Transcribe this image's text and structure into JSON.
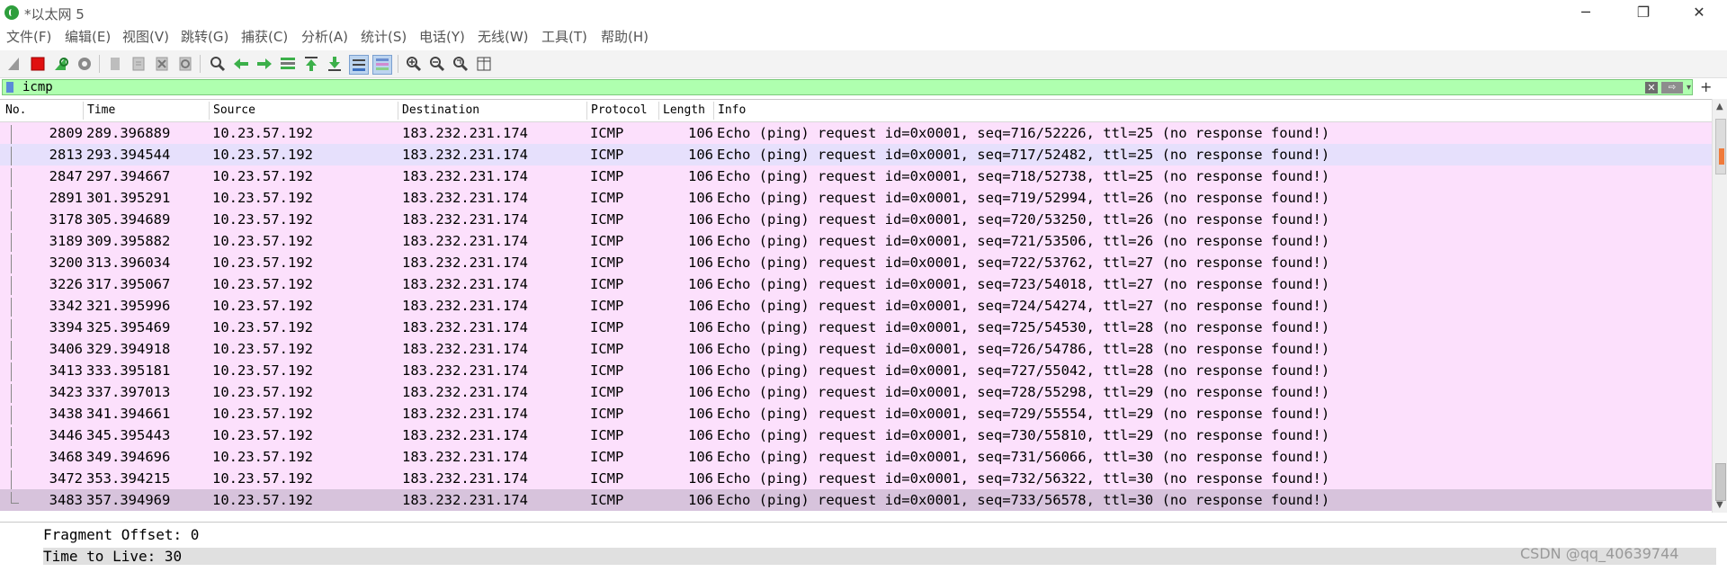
{
  "window": {
    "title": "*以太网 5",
    "minimize": "─",
    "maximize": "❐",
    "close": "✕"
  },
  "menu": [
    "文件(F)",
    "编辑(E)",
    "视图(V)",
    "跳转(G)",
    "捕获(C)",
    "分析(A)",
    "统计(S)",
    "电话(Y)",
    "无线(W)",
    "工具(T)",
    "帮助(H)"
  ],
  "toolbar_icons": [
    "shark-fin-start-icon",
    "stop-capture-icon",
    "restart-capture-icon",
    "capture-options-icon",
    "open-file-icon",
    "save-file-icon",
    "close-file-icon",
    "reload-file-icon",
    "find-packet-icon",
    "go-back-icon",
    "go-forward-icon",
    "go-to-packet-icon",
    "go-first-icon",
    "go-last-icon",
    "autoscroll-icon",
    "colorize-icon",
    "zoom-in-icon",
    "zoom-out-icon",
    "zoom-normal-icon",
    "resize-columns-icon"
  ],
  "filter": {
    "value": "icmp",
    "clear": "✕",
    "apply": "⇨",
    "dropdown": "▾",
    "add": "+"
  },
  "columns": [
    "No.",
    "Time",
    "Source",
    "Destination",
    "Protocol",
    "Length",
    "Info"
  ],
  "packets": [
    {
      "no": "2809",
      "time": "289.396889",
      "src": "10.23.57.192",
      "dst": "183.232.231.174",
      "proto": "ICMP",
      "len": "106",
      "info": "Echo (ping) request  id=0x0001, seq=716/52226, ttl=25 (no response found!)"
    },
    {
      "no": "2813",
      "time": "293.394544",
      "src": "10.23.57.192",
      "dst": "183.232.231.174",
      "proto": "ICMP",
      "len": "106",
      "info": "Echo (ping) request  id=0x0001, seq=717/52482, ttl=25 (no response found!)"
    },
    {
      "no": "2847",
      "time": "297.394667",
      "src": "10.23.57.192",
      "dst": "183.232.231.174",
      "proto": "ICMP",
      "len": "106",
      "info": "Echo (ping) request  id=0x0001, seq=718/52738, ttl=25 (no response found!)"
    },
    {
      "no": "2891",
      "time": "301.395291",
      "src": "10.23.57.192",
      "dst": "183.232.231.174",
      "proto": "ICMP",
      "len": "106",
      "info": "Echo (ping) request  id=0x0001, seq=719/52994, ttl=26 (no response found!)"
    },
    {
      "no": "3178",
      "time": "305.394689",
      "src": "10.23.57.192",
      "dst": "183.232.231.174",
      "proto": "ICMP",
      "len": "106",
      "info": "Echo (ping) request  id=0x0001, seq=720/53250, ttl=26 (no response found!)"
    },
    {
      "no": "3189",
      "time": "309.395882",
      "src": "10.23.57.192",
      "dst": "183.232.231.174",
      "proto": "ICMP",
      "len": "106",
      "info": "Echo (ping) request  id=0x0001, seq=721/53506, ttl=26 (no response found!)"
    },
    {
      "no": "3200",
      "time": "313.396034",
      "src": "10.23.57.192",
      "dst": "183.232.231.174",
      "proto": "ICMP",
      "len": "106",
      "info": "Echo (ping) request  id=0x0001, seq=722/53762, ttl=27 (no response found!)"
    },
    {
      "no": "3226",
      "time": "317.395067",
      "src": "10.23.57.192",
      "dst": "183.232.231.174",
      "proto": "ICMP",
      "len": "106",
      "info": "Echo (ping) request  id=0x0001, seq=723/54018, ttl=27 (no response found!)"
    },
    {
      "no": "3342",
      "time": "321.395996",
      "src": "10.23.57.192",
      "dst": "183.232.231.174",
      "proto": "ICMP",
      "len": "106",
      "info": "Echo (ping) request  id=0x0001, seq=724/54274, ttl=27 (no response found!)"
    },
    {
      "no": "3394",
      "time": "325.395469",
      "src": "10.23.57.192",
      "dst": "183.232.231.174",
      "proto": "ICMP",
      "len": "106",
      "info": "Echo (ping) request  id=0x0001, seq=725/54530, ttl=28 (no response found!)"
    },
    {
      "no": "3406",
      "time": "329.394918",
      "src": "10.23.57.192",
      "dst": "183.232.231.174",
      "proto": "ICMP",
      "len": "106",
      "info": "Echo (ping) request  id=0x0001, seq=726/54786, ttl=28 (no response found!)"
    },
    {
      "no": "3413",
      "time": "333.395181",
      "src": "10.23.57.192",
      "dst": "183.232.231.174",
      "proto": "ICMP",
      "len": "106",
      "info": "Echo (ping) request  id=0x0001, seq=727/55042, ttl=28 (no response found!)"
    },
    {
      "no": "3423",
      "time": "337.397013",
      "src": "10.23.57.192",
      "dst": "183.232.231.174",
      "proto": "ICMP",
      "len": "106",
      "info": "Echo (ping) request  id=0x0001, seq=728/55298, ttl=29 (no response found!)"
    },
    {
      "no": "3438",
      "time": "341.394661",
      "src": "10.23.57.192",
      "dst": "183.232.231.174",
      "proto": "ICMP",
      "len": "106",
      "info": "Echo (ping) request  id=0x0001, seq=729/55554, ttl=29 (no response found!)"
    },
    {
      "no": "3446",
      "time": "345.395443",
      "src": "10.23.57.192",
      "dst": "183.232.231.174",
      "proto": "ICMP",
      "len": "106",
      "info": "Echo (ping) request  id=0x0001, seq=730/55810, ttl=29 (no response found!)"
    },
    {
      "no": "3468",
      "time": "349.394696",
      "src": "10.23.57.192",
      "dst": "183.232.231.174",
      "proto": "ICMP",
      "len": "106",
      "info": "Echo (ping) request  id=0x0001, seq=731/56066, ttl=30 (no response found!)"
    },
    {
      "no": "3472",
      "time": "353.394215",
      "src": "10.23.57.192",
      "dst": "183.232.231.174",
      "proto": "ICMP",
      "len": "106",
      "info": "Echo (ping) request  id=0x0001, seq=732/56322, ttl=30 (no response found!)"
    },
    {
      "no": "3483",
      "time": "357.394969",
      "src": "10.23.57.192",
      "dst": "183.232.231.174",
      "proto": "ICMP",
      "len": "106",
      "info": "Echo (ping) request  id=0x0001, seq=733/56578, ttl=30 (no response found!)"
    }
  ],
  "details": {
    "fragment_offset": "Fragment Offset: 0",
    "ttl": "Time to Live: 30"
  },
  "watermark": "CSDN @qq_40639744",
  "colors": {
    "row_bg": "#fce0fc",
    "row_alt": "#e6e0fc",
    "row_selected": "#d7c3dc",
    "filter_bg": "#afffaf"
  }
}
